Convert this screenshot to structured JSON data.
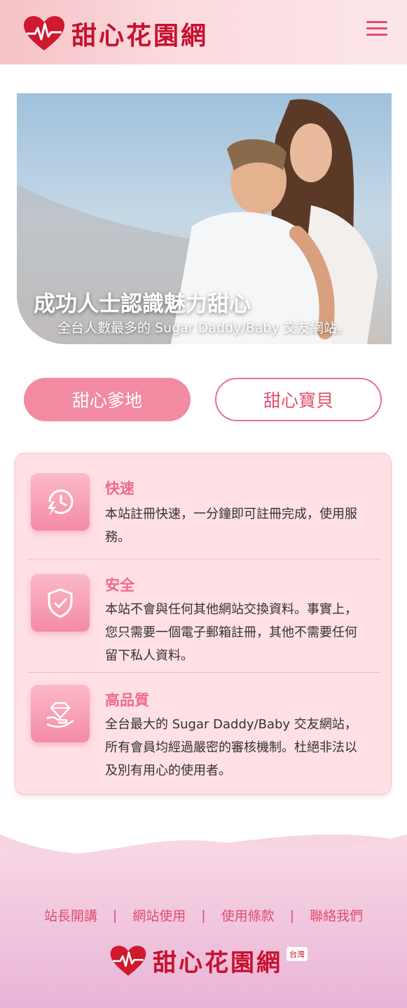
{
  "header": {
    "logo_text": "甜心花園網",
    "menu_icon": "hamburger-icon"
  },
  "hero": {
    "title": "成功人士認識魅力甜心",
    "subtitle": "全台人數最多的 Sugar Daddy/Baby 交友網站。"
  },
  "roles": {
    "daddy_label": "甜心爹地",
    "baby_label": "甜心寶貝"
  },
  "features": [
    {
      "icon": "clock-lightning-icon",
      "title": "快速",
      "desc": "本站註冊快速，一分鐘即可註冊完成，使用服務。"
    },
    {
      "icon": "shield-check-icon",
      "title": "安全",
      "desc": "本站不會與任何其他網站交換資料。事實上，您只需要一個電子郵箱註冊，其他不需要任何留下私人資料。"
    },
    {
      "icon": "diamond-hand-icon",
      "title": "高品質",
      "desc": "全台最大的 Sugar Daddy/Baby 交友網站，所有會員均經過嚴密的審核機制。杜絕非法以及別有用心的使用者。"
    }
  ],
  "footer": {
    "links": [
      "站長開講",
      "網站使用",
      "使用條款",
      "聯絡我們"
    ],
    "separator": "|",
    "logo_text": "甜心花園網",
    "region_tag": "台灣"
  },
  "colors": {
    "brand_red": "#c8102e",
    "accent_pink": "#ef6b89",
    "button_pink": "#f28aa2",
    "card_bg": "#ffe0e5"
  }
}
